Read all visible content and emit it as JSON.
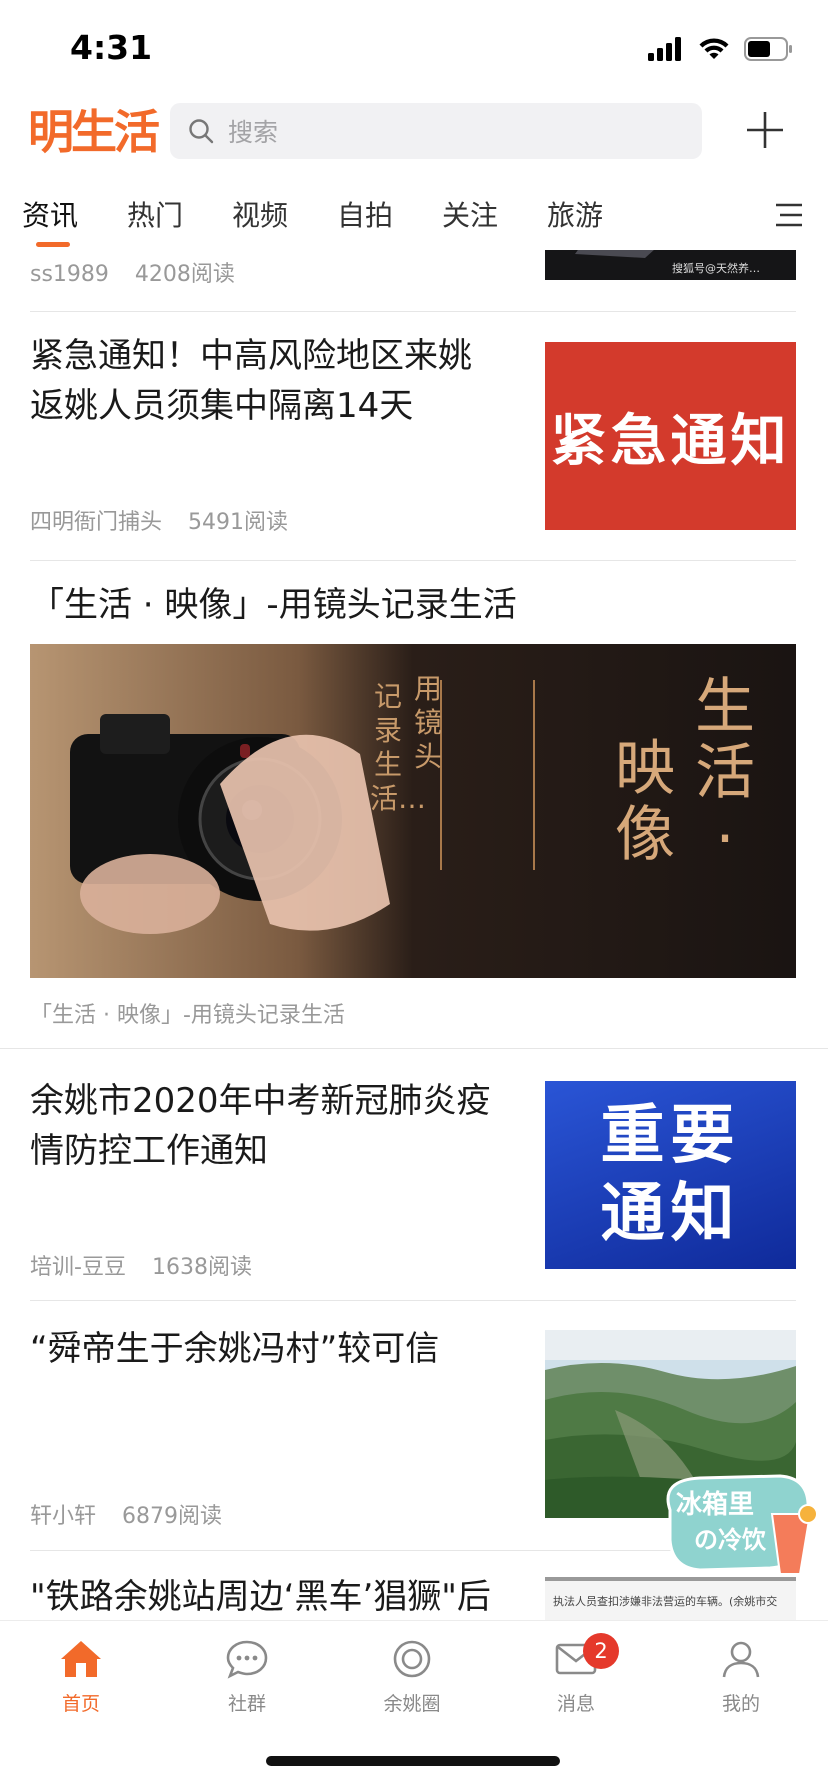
{
  "status_bar": {
    "time": "4:31"
  },
  "header": {
    "logo": "明生活",
    "search_placeholder": "搜索"
  },
  "tabs": [
    {
      "label": "资讯",
      "active": true
    },
    {
      "label": "热门"
    },
    {
      "label": "视频"
    },
    {
      "label": "自拍"
    },
    {
      "label": "关注"
    },
    {
      "label": "旅游"
    }
  ],
  "feed": {
    "partial_item": {
      "author": "ss1989",
      "reads": "4208阅读",
      "thumb_caption": "搜狐号@天然养…"
    },
    "items": [
      {
        "title": "紧急通知！中高风险地区来姚返姚人员须集中隔离14天",
        "author": "四明衙门捕头",
        "reads": "5491阅读",
        "thumb_text": "紧急通知"
      },
      {
        "title": "余姚市2020年中考新冠肺炎疫情防控工作通知",
        "author": "培训-豆豆",
        "reads": "1638阅读",
        "thumb_text_line1": "重要",
        "thumb_text_line2": "通知"
      },
      {
        "title": "“舜帝生于余姚冯村”较可信",
        "author": "轩小轩",
        "reads": "6879阅读"
      },
      {
        "title": "\"铁路余姚站周边‘黑车’猖獗\"后",
        "thumb_caption": "执法人员查扣涉嫌非法营运的车辆。(余姚市交"
      }
    ],
    "banner": {
      "title": "「生活 · 映像」-用镜头记录生活",
      "caption": "「生活 · 映像」-用镜头记录生活",
      "image_big_1": "生活·",
      "image_big_2": "映像",
      "image_col_1": "用镜头",
      "image_col_2": "记录生活…"
    }
  },
  "floating_sticker": {
    "text_line1": "冰箱里",
    "text_line2": "の冷饮"
  },
  "bottom_nav": [
    {
      "label": "首页",
      "icon": "home-icon",
      "active": true
    },
    {
      "label": "社群",
      "icon": "chat-bubble-icon"
    },
    {
      "label": "余姚圈",
      "icon": "circle-icon"
    },
    {
      "label": "消息",
      "icon": "mail-icon",
      "badge": "2"
    },
    {
      "label": "我的",
      "icon": "person-icon"
    }
  ],
  "colors": {
    "accent": "#f26a2a",
    "badge": "#e5392b",
    "urgent_thumb": "#d33a2c",
    "notice_thumb": "#1a3db5"
  }
}
